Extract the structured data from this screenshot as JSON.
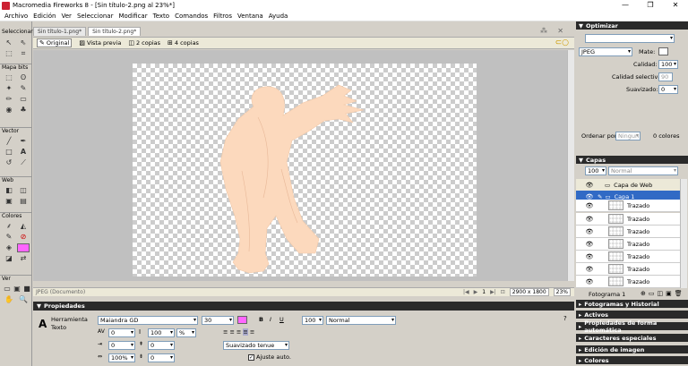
{
  "window": {
    "title": "Macromedia Fireworks 8 - [Sin título-2.png al  23%*]",
    "minimize": "—",
    "maximize": "❐",
    "close": "✕"
  },
  "menu": [
    "Archivo",
    "Edición",
    "Ver",
    "Seleccionar",
    "Modificar",
    "Texto",
    "Comandos",
    "Filtros",
    "Ventana",
    "Ayuda"
  ],
  "tools": {
    "sections": [
      "Seleccionar",
      "Mapa bits",
      "Vector",
      "Web",
      "Colores",
      "Ver"
    ]
  },
  "document": {
    "tabs": [
      "Sin título-1.png*",
      "Sin título-2.png*"
    ],
    "views": [
      "Original",
      "Vista previa",
      "2 copias",
      "4 copias"
    ],
    "status": {
      "format": "JPEG (Documento)",
      "frame": "1",
      "dimensions": "2900 x 1800",
      "zoom": "23%"
    }
  },
  "properties": {
    "title": "Propiedades",
    "tool_name": "Herramienta Texto",
    "font": "Maiandra GD",
    "size": "30",
    "text_color": "#ff66ff",
    "opacity": "100",
    "blend": "Normal",
    "kerning": "0",
    "leading": "100",
    "leading_unit": "%",
    "indent": "0",
    "space_before": "0",
    "space_after": "0",
    "scale": "100%",
    "baseline": "0",
    "antialias": "Suavizado tenue",
    "autokern_label": "Ajuste auto.",
    "style_buttons": [
      "B",
      "I",
      "U"
    ]
  },
  "optimize": {
    "title": "Optimizar",
    "format": "JPEG",
    "matte_label": "Mate:",
    "quality_label": "Calidad:",
    "quality": "100",
    "selective_label": "Calidad selectiva:",
    "selective": "90",
    "smoothing_label": "Suavizado:",
    "smoothing": "0",
    "sort_label": "Ordenar por:",
    "sort_value": "Ningun",
    "colors": "0 colores"
  },
  "layers": {
    "title": "Capas",
    "opacity": "100",
    "blend": "Normal",
    "items": [
      {
        "name": "Capa de Web",
        "type": "top"
      },
      {
        "name": "Capa 1",
        "type": "selected"
      },
      {
        "name": "Trazado",
        "type": "sub"
      },
      {
        "name": "Trazado",
        "type": "sub"
      },
      {
        "name": "Trazado",
        "type": "sub"
      },
      {
        "name": "Trazado",
        "type": "sub"
      },
      {
        "name": "Trazado",
        "type": "sub"
      },
      {
        "name": "Trazado",
        "type": "sub"
      },
      {
        "name": "Trazado",
        "type": "sub"
      }
    ],
    "frame": "Fotograma 1"
  },
  "panels": [
    "Fotogramas y Historial",
    "Activos",
    "Propiedades de forma automática",
    "Caracteres especiales",
    "Edición de imagen",
    "Colores"
  ],
  "figure_color": "#fcd9bd"
}
